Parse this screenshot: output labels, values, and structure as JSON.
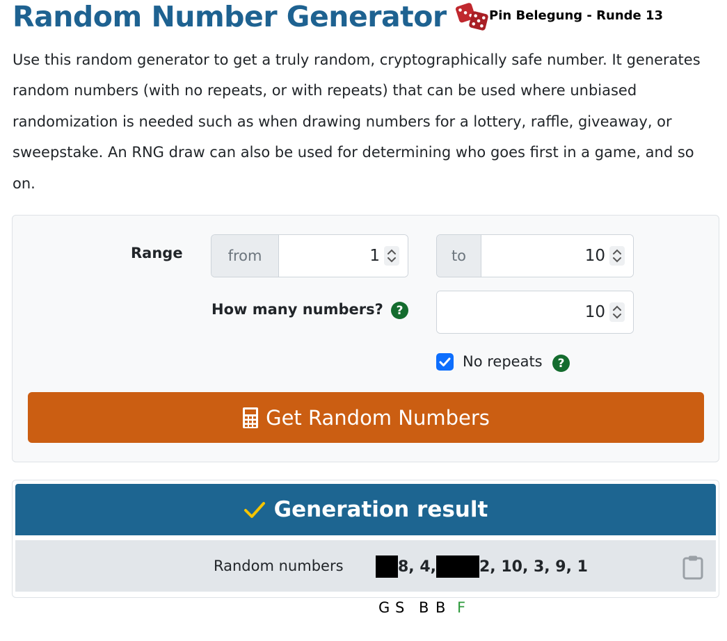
{
  "header": {
    "title": "Random Number Generator",
    "dice_icon": "dice-icon",
    "overlay_label": "Pin Belegung - Runde 13"
  },
  "intro": "Use this random generator to get a truly random, cryptographically safe number. It generates random numbers (with no repeats, or with repeats) that can be used where unbiased randomization is needed such as when drawing numbers for a lottery, raffle, giveaway, or sweepstake. An RNG draw can also be used for determining who goes first in a game, and so on.",
  "form": {
    "range_label": "Range",
    "from_addon": "from",
    "from_value": "1",
    "to_addon": "to",
    "to_value": "10",
    "howmany_label": "How many numbers?",
    "howmany_value": "10",
    "help_glyph": "?",
    "no_repeats_label": "No repeats",
    "no_repeats_checked": true,
    "button_label": "Get Random Numbers",
    "button_icon": "calculator-icon"
  },
  "result": {
    "header": "Generation result",
    "header_icon": "check-icon",
    "label": "Random numbers",
    "value_1": "8, 4,",
    "value_2": "2, 10, 3, 9, 1",
    "clipboard_icon": "clipboard-icon"
  },
  "legend": {
    "g": "G",
    "s": "S",
    "b1": "B",
    "b2": "B",
    "f": "F"
  },
  "colors": {
    "title": "#1e6291",
    "button": "#cb5e12",
    "result_header": "#1d6591",
    "help": "#146c2e",
    "checkbox": "#0d6efd",
    "check_mark": "#f5c400",
    "legend_f": "#2e9a3c"
  }
}
